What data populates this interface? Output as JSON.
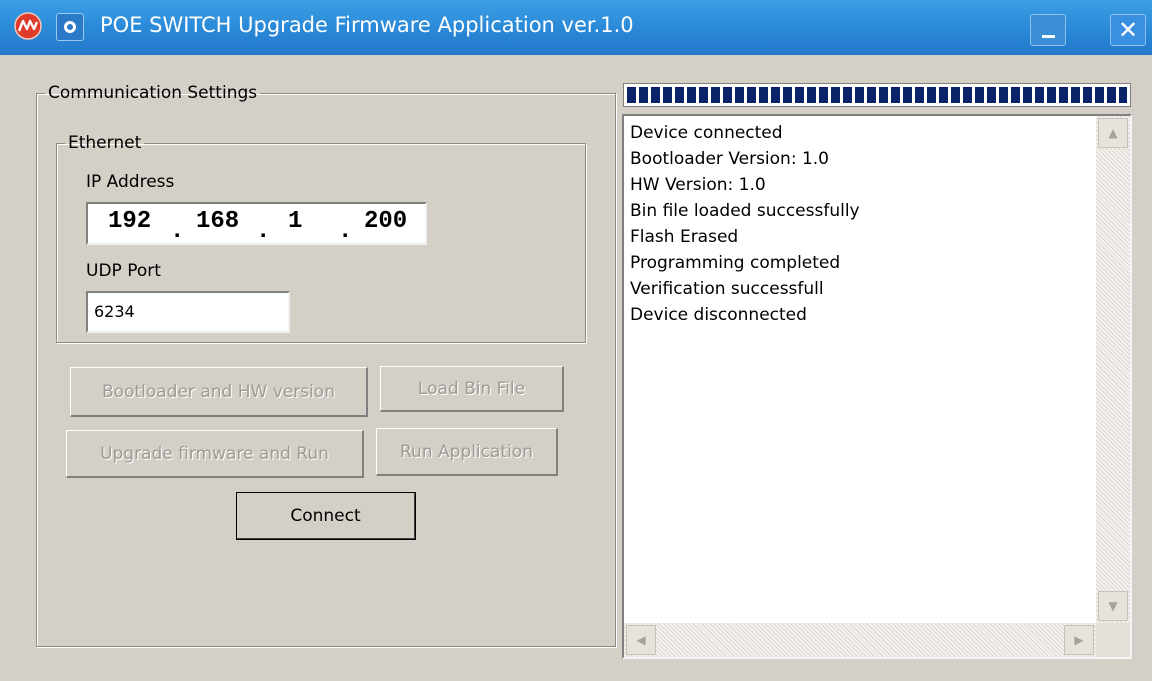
{
  "window": {
    "title": "POE SWITCH Upgrade Firmware Application ver.1.0",
    "minimize_icon": "minimize-icon",
    "close_glyph": "✕"
  },
  "communication": {
    "legend": "Communication Settings",
    "ethernet": {
      "legend": "Ethernet",
      "ip_label": "IP Address",
      "ip_octets": [
        "192",
        "168",
        "1",
        "200"
      ],
      "ip_separator": ".",
      "port_label": "UDP Port",
      "port_value": "6234"
    }
  },
  "buttons": {
    "bootloader_hw": "Bootloader and HW version",
    "load_bin": "Load Bin File",
    "upgrade_run": "Upgrade firmware and Run",
    "run_app": "Run Application",
    "connect": "Connect"
  },
  "progress": {
    "value": 1.0
  },
  "log": {
    "lines": [
      "Device connected",
      "Bootloader Version: 1.0",
      "HW Version: 1.0",
      "Bin file loaded successfully",
      "Flash Erased",
      "Programming completed",
      "Verification successfull",
      "Device disconnected"
    ],
    "scroll_up": "▲",
    "scroll_down": "▼",
    "scroll_left": "◀",
    "scroll_right": "▶"
  },
  "colors": {
    "titlebar": "#2b8ad8",
    "progress_fill": "#0a246a",
    "window_bg": "#d4d0c8"
  }
}
